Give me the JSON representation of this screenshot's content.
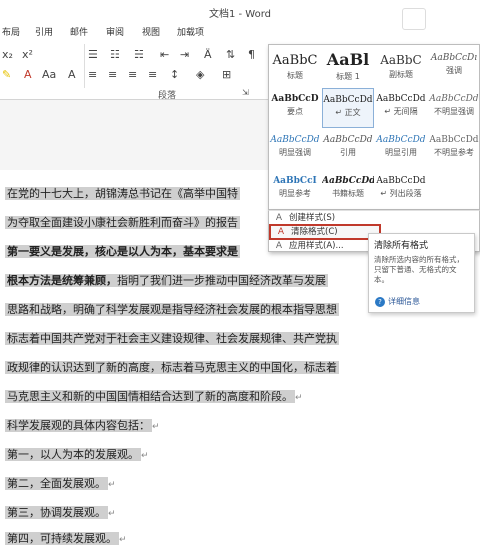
{
  "window": {
    "title": "文档1 - Word"
  },
  "tabs": [
    "布局",
    "引用",
    "邮件",
    "审阅",
    "视图",
    "加载项"
  ],
  "groups": {
    "paragraph": "段落"
  },
  "styles": [
    {
      "sample": "AaBbC",
      "name": "标题"
    },
    {
      "sample": "AaBl",
      "name": "标题 1"
    },
    {
      "sample": "AaBbC",
      "name": "副标题"
    },
    {
      "sample": "AaBbCcDı",
      "name": "强调"
    },
    {
      "sample": "AaBbCcD",
      "name": "要点"
    },
    {
      "sample": "AaBbCcDd",
      "name": "↵ 正文"
    },
    {
      "sample": "AaBbCcDd",
      "name": "↵ 无间隔"
    },
    {
      "sample": "AaBbCcDd",
      "name": "不明显强调"
    },
    {
      "sample": "AaBbCcDd",
      "name": "明显强调"
    },
    {
      "sample": "AaBbCcDd",
      "name": "引用"
    },
    {
      "sample": "AaBbCcDd",
      "name": "明显引用"
    },
    {
      "sample": "AaBbCcDd",
      "name": "不明显参考"
    },
    {
      "sample": "AaBbCcI",
      "name": "明显参考"
    },
    {
      "sample": "AaBbCcDd",
      "name": "书籍标题"
    },
    {
      "sample": "AaBbCcDd",
      "name": "↵ 列出段落"
    }
  ],
  "style_menu": [
    {
      "label": "创建样式(S)",
      "icon": "A"
    },
    {
      "label": "清除格式(C)",
      "icon": "A"
    },
    {
      "label": "应用样式(A)...",
      "icon": "A"
    }
  ],
  "tooltip": {
    "title": "清除所有格式",
    "body": "清除所选内容的所有格式，只留下普通、无格式的文本。",
    "link": "详细信息"
  },
  "document": {
    "lines": [
      {
        "text": "在党的十七大上，胡锦涛总书记在《高举中国特",
        "bold": false
      },
      {
        "text": "为夺取全面建设小康社会新胜利而奋斗》的报告",
        "bold": false
      },
      {
        "text": "第一要义是发展，核心是以人为本，基本要求是",
        "bold": true
      },
      {
        "text": "根本方法是统筹兼顾，",
        "bold": true,
        "rest": "指明了我们进一步推动中国经济改革与发展"
      },
      {
        "text": "思路和战略，明确了科学发展观是指导经济社会发展的根本指导思想",
        "bold": false
      },
      {
        "text": "标志着中国共产党对于社会主义建设规律、社会发展规律、共产党执",
        "bold": false
      },
      {
        "text": "政规律的认识达到了新的高度，标志着马克思主义的中国化，标志着",
        "bold": false
      },
      {
        "text": "马克思主义和新的中国国情相结合达到了新的高度和阶段。",
        "bold": false,
        "mark": "↵"
      },
      {
        "text": "科学发展观的具体内容包括：",
        "bold": false,
        "mark": "↵"
      },
      {
        "text": "第一，以人为本的发展观。",
        "bold": false,
        "mark": "↵"
      },
      {
        "text": "第二，全面发展观。",
        "bold": false,
        "mark": "↵"
      },
      {
        "text": "第三，协调发展观。",
        "bold": false,
        "mark": "↵"
      },
      {
        "text": "第四，可持续发展观。",
        "bold": false,
        "mark": "↵"
      }
    ]
  }
}
